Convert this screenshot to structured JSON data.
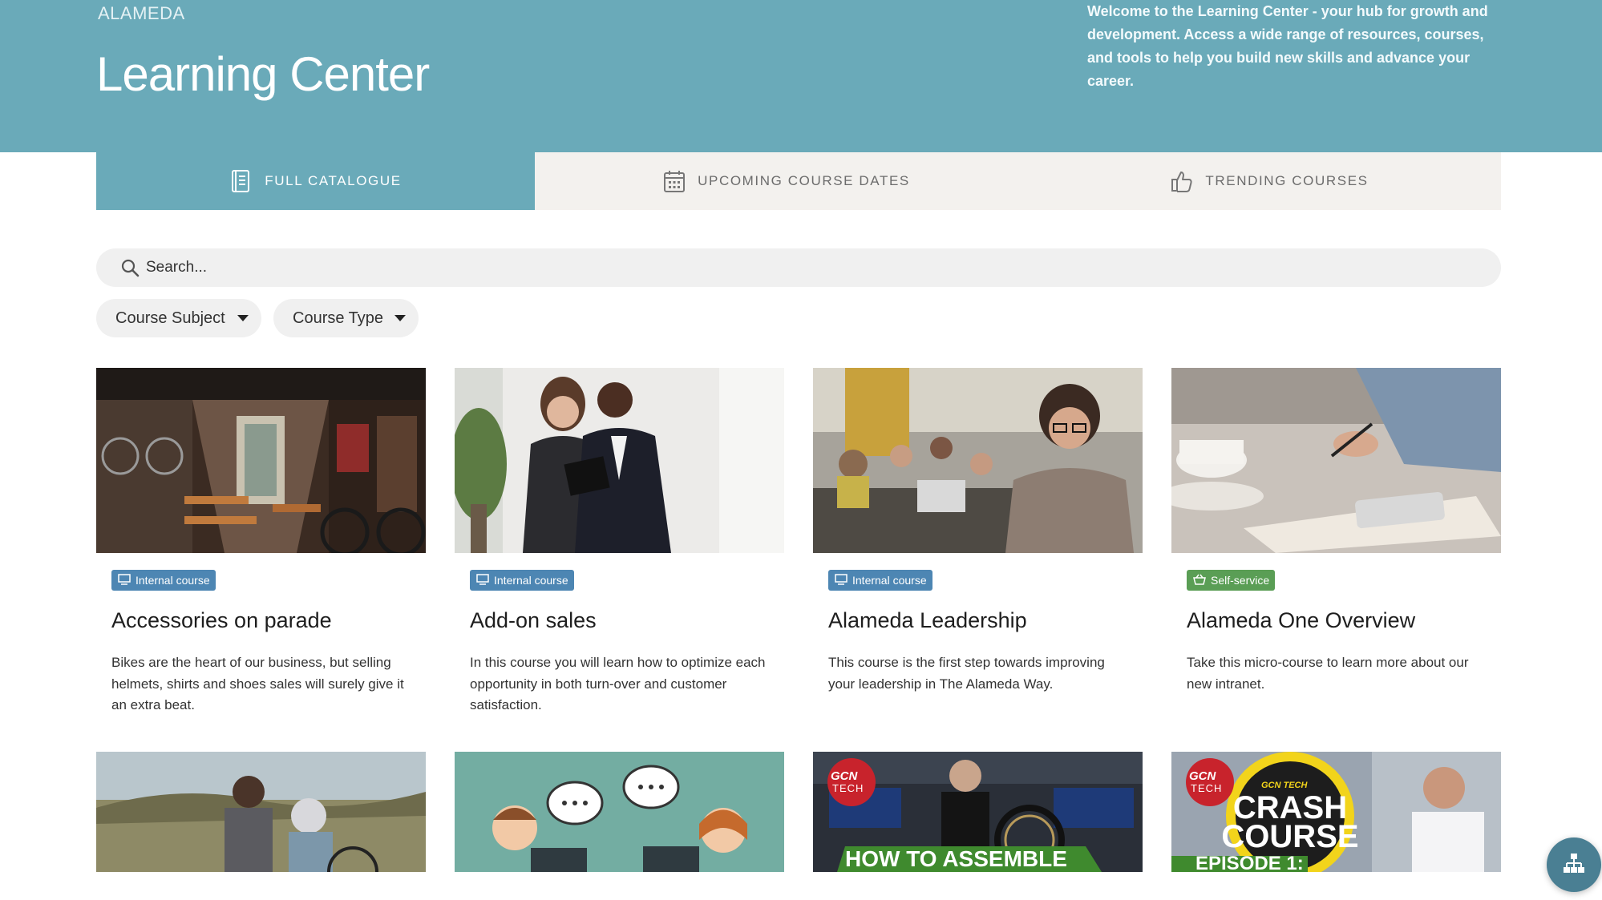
{
  "header": {
    "brand": "ALAMEDA",
    "title": "Learning Center",
    "welcome": "Welcome to the Learning Center - your hub for growth and development. Access a wide range of resources, courses, and tools to help you build new skills and advance your career."
  },
  "tabs": [
    {
      "label": "FULL CATALOGUE",
      "icon": "catalogue-icon",
      "active": true
    },
    {
      "label": "UPCOMING COURSE DATES",
      "icon": "calendar-icon",
      "active": false
    },
    {
      "label": "TRENDING COURSES",
      "icon": "thumbs-up-icon",
      "active": false
    }
  ],
  "search": {
    "placeholder": "Search..."
  },
  "filters": [
    {
      "label": "Course Subject"
    },
    {
      "label": "Course Type"
    }
  ],
  "courses": [
    {
      "badge": "Internal course",
      "title": "Accessories on parade",
      "description": "Bikes are the heart of our business, but selling helmets, shirts and shoes sales will surely give it an extra beat."
    },
    {
      "badge": "Internal course",
      "title": "Add-on sales",
      "description": "In this course you will learn how to optimize each opportunity in both turn-over and customer satisfaction."
    },
    {
      "badge": "Internal course",
      "title": "Alameda Leadership",
      "description": "This course is the first step towards improving your leadership in The Alameda Way."
    },
    {
      "badge": "Self-service",
      "title": "Alameda One Overview",
      "description": "Take this micro-course to learn more about our new intranet."
    }
  ],
  "thumbnails": {
    "gcn_logo_top": "GCN",
    "gcn_logo_bottom": "TECH",
    "video3_caption": "HOW TO ASSEMBLE",
    "video4_brand": "GCN TECH",
    "video4_title_1": "CRASH",
    "video4_title_2": "COURSE",
    "video4_episode": "EPISODE 1:"
  },
  "colors": {
    "hero": "#6aaab9",
    "tab_inactive": "#f3f1ee",
    "badge_internal": "#4d86b3",
    "badge_self": "#5a9e55",
    "fab": "#4a7f93"
  }
}
